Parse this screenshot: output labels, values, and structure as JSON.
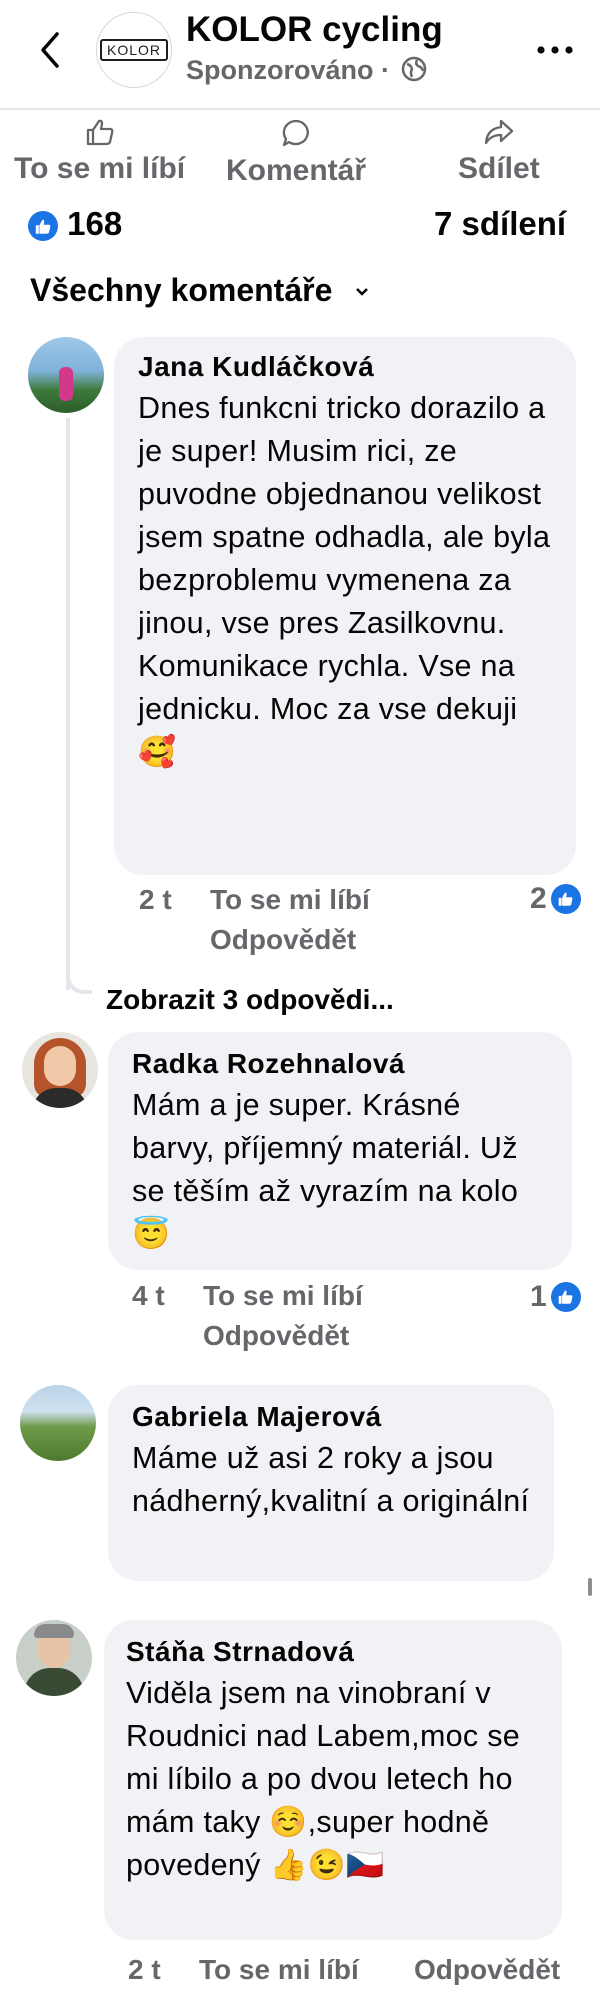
{
  "header": {
    "page_name": "KOLOR cycling",
    "sponsored": "Sponzorováno ·",
    "logo_text": "KOLOR"
  },
  "actions": {
    "like": "To se mi líbí",
    "comment": "Komentář",
    "share": "Sdílet"
  },
  "stats": {
    "reactions": "168",
    "shares": "7 sdílení"
  },
  "sort_label": "Všechny komentáře",
  "comments": [
    {
      "author": "Jana Kudláčková",
      "text": "Dnes funkcni tricko dorazilo a je super! Musim rici, ze puvodne objednanou velikost jsem spatne odhadla, ale byla bezproblemu vymenena za jinou, vse pres Zasilkovnu. Komunikace rychla. Vse na jednicku. Moc za vse dekuji 🥰",
      "time": "2 t",
      "like": "To se mi líbí",
      "reply": "Odpovědět",
      "reactions": "2",
      "replies_link": "Zobrazit 3 odpovědi..."
    },
    {
      "author": "Radka Rozehnalová",
      "text": "Mám a je super. Krásné barvy, příjemný materiál. Už se těším až vyrazím na kolo 😇",
      "time": "4 t",
      "like": "To se mi líbí",
      "reply": "Odpovědět",
      "reactions": "1"
    },
    {
      "author": "Gabriela Majerová",
      "text": "Máme už asi 2 roky a jsou nádherný,kvalitní a originální"
    },
    {
      "author": "Stáňa Strnadová",
      "text": "Viděla jsem na vinobraní v Roudnici nad Labem,moc se mi líbilo a po dvou letech ho mám taky ☺️,super hodně povedený 👍😉🇨🇿",
      "time": "2 t",
      "like": "To se mi líbí",
      "reply": "Odpovědět"
    }
  ],
  "icons": {
    "back": "chevron-left-icon",
    "globe": "globe-icon",
    "more": "more-dots-icon",
    "like": "thumbs-up-icon",
    "comment": "comment-bubble-icon",
    "share": "share-arrow-icon",
    "chevron": "chevron-down-icon"
  },
  "colors": {
    "accent": "#1b74e4",
    "secondary_text": "#65676b",
    "bubble": "#f0f2f5"
  }
}
